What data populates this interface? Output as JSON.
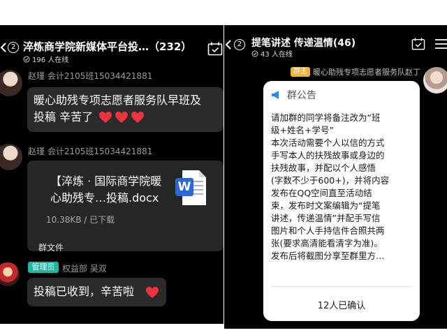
{
  "left": {
    "header": {
      "badge": "2",
      "title": "淬炼商学院新媒体平台投…（232）",
      "online": "196 人在线"
    },
    "messages": [
      {
        "sender": "赵瑾 会计2105班15034421881",
        "lines": [
          "暖心助残专项志愿者服务队早班及",
          "投稿 辛苦了"
        ],
        "hearts": 3
      },
      {
        "sender": "赵瑾 会计2105班15034421881",
        "file": {
          "name_lines": [
            "【淬炼 · 国际商学院暖",
            "心助残专…投稿.docx"
          ],
          "meta": "10.38KB / 已下载",
          "icon_letter": "W"
        }
      },
      {
        "footer": "群文件"
      },
      {
        "role": "管理员",
        "sender": "权益部  吴双",
        "lines": [
          "投稿已收到，辛苦啦"
        ],
        "hearts": 1
      }
    ]
  },
  "right": {
    "header": {
      "badge": "2",
      "title": "提笔讲述 传递温情(46)",
      "online": "43 人在线"
    },
    "owner_badge": "群主",
    "owner_name": "暖心助残专项志愿者服务队赵丁",
    "notice": {
      "title": "群公告",
      "lines": [
        "请加群的同学将备注改为“班",
        "级+姓名+学号”",
        "本次活动需要个人以信的方式",
        "手写本人的扶残故事或身边的",
        "扶残故事，并配以个人感悟",
        "(字数不少于600+)，并将内容",
        "发布在QQ空间直至活动结",
        "束，发布时文案编辑为“提笔",
        "讲述，传递温情”并配手写信",
        "图片和个人手持信件合照共两",
        "张(要求高清能看清字为准)。",
        "发布后将截图分享至群里方…"
      ],
      "confirm": "12人已确认"
    }
  },
  "colors": {
    "heart": "#f0333f",
    "admin_badge": "#1fb6a4",
    "owner_badge": "#f3b33d",
    "notice_blue": "#2b8cf4",
    "word_blue": "#2b67d6"
  }
}
